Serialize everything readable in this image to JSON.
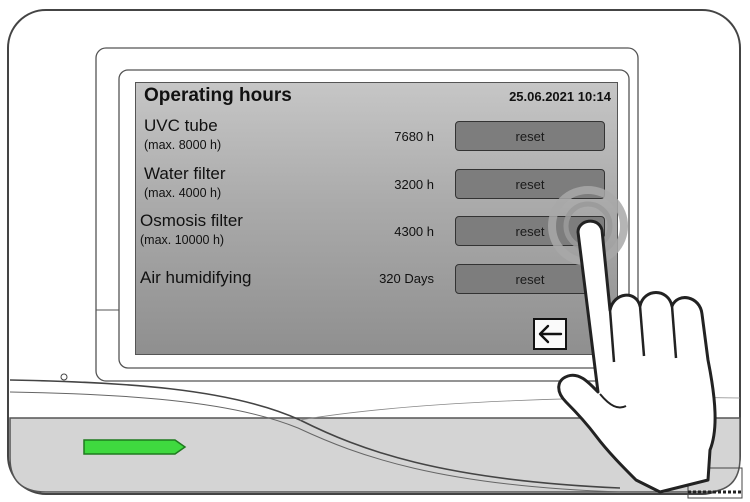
{
  "screen": {
    "title": "Operating hours",
    "datetime": "25.06.2021  10:14",
    "items": [
      {
        "name": "UVC tube",
        "max": "(max. 8000 h)",
        "value": "7680 h",
        "button": "reset"
      },
      {
        "name": "Water filter",
        "max": "(max. 4000 h)",
        "value": "3200 h",
        "button": "reset"
      },
      {
        "name": "Osmosis filter",
        "max": "(max. 10000 h)",
        "value": "4300 h",
        "button": "reset"
      },
      {
        "name": "Air humidifying",
        "max": "",
        "value": "320 Days",
        "button": "reset"
      }
    ]
  },
  "icons": {
    "back": "back-arrow-icon",
    "led": "status-led-icon",
    "hand": "pointing-hand-icon"
  },
  "colors": {
    "led": "#3fd93f",
    "screen_bg": "#a8a8a8",
    "button_bg": "#7d7d7d"
  }
}
